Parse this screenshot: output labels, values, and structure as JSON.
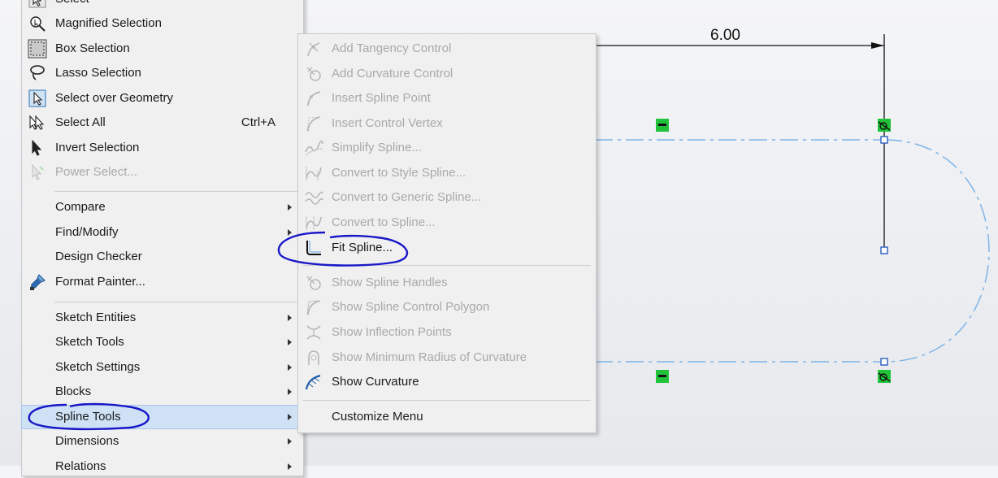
{
  "dimension": {
    "value": "6.00"
  },
  "main_menu": {
    "items": [
      {
        "label": "Select",
        "icon": "select-arrow-icon",
        "disabled": false
      },
      {
        "label": "Magnified Selection",
        "icon": "magnifier-icon",
        "disabled": false
      },
      {
        "label": "Box Selection",
        "icon": "box-selection-icon",
        "disabled": false
      },
      {
        "label": "Lasso Selection",
        "icon": "lasso-icon",
        "disabled": false
      },
      {
        "label": "Select over Geometry",
        "icon": "select-over-geometry-icon",
        "disabled": false
      },
      {
        "label": "Select All",
        "shortcut": "Ctrl+A",
        "icon": "select-all-icon",
        "disabled": false
      },
      {
        "label": "Invert Selection",
        "icon": "invert-selection-icon",
        "disabled": false
      },
      {
        "label": "Power Select...",
        "icon": "power-select-icon",
        "disabled": true
      },
      {
        "label": "Compare",
        "submenu": true
      },
      {
        "label": "Find/Modify",
        "submenu": true
      },
      {
        "label": "Design Checker"
      },
      {
        "label": "Format Painter...",
        "icon": "format-painter-icon"
      },
      {
        "label": "Sketch Entities",
        "submenu": true
      },
      {
        "label": "Sketch Tools",
        "submenu": true
      },
      {
        "label": "Sketch Settings",
        "submenu": true
      },
      {
        "label": "Blocks",
        "submenu": true
      },
      {
        "label": "Spline Tools",
        "submenu": true,
        "highlighted": true
      },
      {
        "label": "Dimensions",
        "submenu": true
      },
      {
        "label": "Relations",
        "submenu": true
      }
    ]
  },
  "spline_submenu": {
    "items": [
      {
        "label": "Add Tangency Control",
        "icon": "add-tangency-control-icon",
        "disabled": true
      },
      {
        "label": "Add Curvature Control",
        "icon": "add-curvature-control-icon",
        "disabled": true
      },
      {
        "label": "Insert Spline Point",
        "icon": "insert-spline-point-icon",
        "disabled": true
      },
      {
        "label": "Insert Control Vertex",
        "icon": "insert-control-vertex-icon",
        "disabled": true
      },
      {
        "label": "Simplify Spline...",
        "icon": "simplify-spline-icon",
        "disabled": true
      },
      {
        "label": "Convert to Style Spline...",
        "icon": "convert-style-spline-icon",
        "disabled": true
      },
      {
        "label": "Convert to Generic Spline...",
        "icon": "convert-generic-spline-icon",
        "disabled": true
      },
      {
        "label": "Convert to Spline...",
        "icon": "convert-to-spline-icon",
        "disabled": true
      },
      {
        "label": "Fit Spline...",
        "icon": "fit-spline-icon",
        "disabled": false
      },
      {
        "label": "Show Spline Handles",
        "icon": "show-spline-handles-icon",
        "disabled": true
      },
      {
        "label": "Show Spline Control Polygon",
        "icon": "show-control-polygon-icon",
        "disabled": true
      },
      {
        "label": "Show Inflection Points",
        "icon": "show-inflection-points-icon",
        "disabled": true
      },
      {
        "label": "Show Minimum Radius of Curvature",
        "icon": "show-min-radius-icon",
        "disabled": true
      },
      {
        "label": "Show Curvature",
        "icon": "show-curvature-icon",
        "disabled": false
      },
      {
        "label": "Customize Menu",
        "disabled": false
      }
    ]
  },
  "colors": {
    "sketch_line": "#7eb4ea",
    "relation_marker": "#22c33a",
    "annotation_ink": "#1818c8"
  }
}
